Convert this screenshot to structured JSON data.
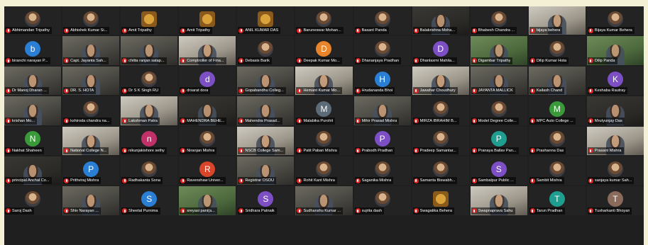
{
  "colors": {
    "frame_background": "#f4f0d6",
    "tile_background": "#232323",
    "muted_mic": "#e02424"
  },
  "participants": [
    {
      "name": "Abhimandan Tripathy",
      "view": "avatar",
      "avatar_kind": "photo"
    },
    {
      "name": "Abhishek Kumar Si...",
      "view": "avatar",
      "avatar_kind": "photo"
    },
    {
      "name": "Amit Tripathy",
      "view": "avatar",
      "avatar_kind": "logo"
    },
    {
      "name": "Amit Tripathy",
      "view": "avatar",
      "avatar_kind": "logo"
    },
    {
      "name": "ANIL KUMAR DAS",
      "view": "avatar",
      "avatar_kind": "logo"
    },
    {
      "name": "Baruneswar Mohan...",
      "view": "avatar",
      "avatar_kind": "photo"
    },
    {
      "name": "Basant Panda",
      "view": "avatar",
      "avatar_kind": "photo"
    },
    {
      "name": "Balakrishna Moha...",
      "view": "video",
      "tone": "dark"
    },
    {
      "name": "Bhabesh Chandra ...",
      "view": "avatar",
      "avatar_kind": "photo"
    },
    {
      "name": "bijaya behera",
      "view": "video",
      "tone": "light"
    },
    {
      "name": "Bijaya Kumar Behera",
      "view": "avatar",
      "avatar_kind": "photo"
    },
    {
      "name": "biranchi narayan P...",
      "view": "avatar",
      "avatar_kind": "initial",
      "initial": "b",
      "color": "#2a7fd4"
    },
    {
      "name": "Capt. Jayanta Sah...",
      "view": "video",
      "tone": "mid"
    },
    {
      "name": "chitta ranjan satap...",
      "view": "video",
      "tone": "mid"
    },
    {
      "name": "Comptroller of Fina...",
      "view": "video",
      "tone": "light"
    },
    {
      "name": "Debasis Barik",
      "view": "avatar",
      "avatar_kind": "photo"
    },
    {
      "name": "Deepak Kumar Mo...",
      "view": "avatar",
      "avatar_kind": "initial",
      "initial": "D",
      "color": "#e8842a"
    },
    {
      "name": "Dhananjaya Pradhan",
      "view": "avatar",
      "avatar_kind": "photo"
    },
    {
      "name": "Dhanlaxmi Mahila...",
      "view": "avatar",
      "avatar_kind": "initial",
      "initial": "D",
      "color": "#7d4fc4"
    },
    {
      "name": "Digambar Tripathy",
      "view": "video",
      "tone": "green"
    },
    {
      "name": "Dilip Kumar Hota",
      "view": "avatar",
      "avatar_kind": "photo"
    },
    {
      "name": "Dilip Panda",
      "view": "video",
      "tone": "green"
    },
    {
      "name": "Dr Manoj Dharan ...",
      "view": "video",
      "tone": "mid"
    },
    {
      "name": "DR. S. HOTA",
      "view": "video",
      "tone": "mid"
    },
    {
      "name": "Dr S K Singh RU",
      "view": "avatar",
      "avatar_kind": "photo"
    },
    {
      "name": "drsarat dora",
      "view": "avatar",
      "avatar_kind": "initial",
      "initial": "d",
      "color": "#7d4fc4"
    },
    {
      "name": "Gopabandhu Colleg...",
      "view": "video",
      "tone": "mid"
    },
    {
      "name": "Hemant Kumar Mo...",
      "view": "video",
      "tone": "light"
    },
    {
      "name": "Hrudananda Bhoi",
      "view": "avatar",
      "avatar_kind": "initial",
      "initial": "H",
      "color": "#2a7fd4"
    },
    {
      "name": "Jawahar Choudhury",
      "view": "video",
      "tone": "light"
    },
    {
      "name": "JAYANTA MALLICK",
      "view": "video",
      "tone": "mid"
    },
    {
      "name": "Kailash Chand",
      "view": "video",
      "tone": "mid"
    },
    {
      "name": "Keshaba Rautray",
      "view": "avatar",
      "avatar_kind": "initial",
      "initial": "K",
      "color": "#7d4fc4"
    },
    {
      "name": "krishan Mo...",
      "view": "video",
      "tone": "mid"
    },
    {
      "name": "kshiroda chandra na...",
      "view": "avatar",
      "avatar_kind": "photo"
    },
    {
      "name": "Lakshman Patra",
      "view": "video",
      "tone": "light"
    },
    {
      "name": "MAHENDRA BEHE...",
      "view": "video",
      "tone": "dark"
    },
    {
      "name": "Mahendra Prasad...",
      "view": "video",
      "tone": "mid"
    },
    {
      "name": "Malabika Purohit",
      "view": "avatar",
      "avatar_kind": "initial",
      "initial": "M",
      "color": "#5c6b78"
    },
    {
      "name": "Mihir Prasad Mishra",
      "view": "video",
      "tone": "mid"
    },
    {
      "name": "MIRZA IBRAHIM B...",
      "view": "avatar",
      "avatar_kind": "photo"
    },
    {
      "name": "Model Degree Colle...",
      "view": "avatar",
      "avatar_kind": "photo"
    },
    {
      "name": "MPC Auto College ...",
      "view": "avatar",
      "avatar_kind": "initial",
      "initial": "M",
      "color": "#3a9a3a"
    },
    {
      "name": "Mrutyunjay Das",
      "view": "video",
      "tone": "dark"
    },
    {
      "name": "Nakhat Shaheen",
      "view": "avatar",
      "avatar_kind": "initial",
      "initial": "N",
      "color": "#3a9a3a"
    },
    {
      "name": "National College N...",
      "view": "video",
      "tone": "light"
    },
    {
      "name": "nikunjakishore sethy",
      "view": "avatar",
      "avatar_kind": "initial",
      "initial": "n",
      "color": "#c2306a"
    },
    {
      "name": "Niranjan Mishra",
      "view": "avatar",
      "avatar_kind": "photo"
    },
    {
      "name": "NSCB College Sam...",
      "view": "video",
      "tone": "light"
    },
    {
      "name": "Patit Paban Mishra",
      "view": "avatar",
      "avatar_kind": "photo"
    },
    {
      "name": "Prabodh Pradhan",
      "view": "avatar",
      "avatar_kind": "initial",
      "initial": "P",
      "color": "#7d4fc4"
    },
    {
      "name": "Pradeep Samantar...",
      "view": "avatar",
      "avatar_kind": "photo"
    },
    {
      "name": "Pranaya Ballav Pan...",
      "view": "avatar",
      "avatar_kind": "initial",
      "initial": "P",
      "color": "#1f9d8f"
    },
    {
      "name": "Prashanna Das",
      "view": "avatar",
      "avatar_kind": "photo"
    },
    {
      "name": "Prasant Mishra",
      "view": "video",
      "tone": "light"
    },
    {
      "name": "principal Anchal Co...",
      "view": "video",
      "tone": "dark"
    },
    {
      "name": "Prithviraj Mishra",
      "view": "avatar",
      "avatar_kind": "initial",
      "initial": "P",
      "color": "#2a7fd4"
    },
    {
      "name": "Radhakanta Sona",
      "view": "avatar",
      "avatar_kind": "photo"
    },
    {
      "name": "Ravenshaw Univer...",
      "view": "avatar",
      "avatar_kind": "initial",
      "initial": "R",
      "color": "#d8452a"
    },
    {
      "name": "Registrar OSOU",
      "view": "video",
      "tone": "mid"
    },
    {
      "name": "Rohit Kant Mishra",
      "view": "avatar",
      "avatar_kind": "photo"
    },
    {
      "name": "Saganika Mishra",
      "view": "avatar",
      "avatar_kind": "photo"
    },
    {
      "name": "Samanta Biswabh...",
      "view": "avatar",
      "avatar_kind": "photo"
    },
    {
      "name": "Sambalpur Public ...",
      "view": "avatar",
      "avatar_kind": "initial",
      "initial": "S",
      "color": "#7d4fc4"
    },
    {
      "name": "Sambit Mishra",
      "view": "avatar",
      "avatar_kind": "photo"
    },
    {
      "name": "sanjaya kumar Sah...",
      "view": "avatar",
      "avatar_kind": "photo"
    },
    {
      "name": "Saroj Dash",
      "view": "avatar",
      "avatar_kind": "photo"
    },
    {
      "name": "Shiv Narayan ...",
      "view": "video",
      "tone": "mid"
    },
    {
      "name": "Sheetal Purnima",
      "view": "avatar",
      "avatar_kind": "initial",
      "initial": "S",
      "color": "#2a7fd4"
    },
    {
      "name": "sreyasi pani(a...",
      "view": "video",
      "tone": "green"
    },
    {
      "name": "Sridhara Patnaik",
      "view": "avatar",
      "avatar_kind": "initial",
      "initial": "S",
      "color": "#7d4fc4"
    },
    {
      "name": "Sudhanshu Kumar ...",
      "view": "video",
      "tone": "mid"
    },
    {
      "name": "sujrita dash",
      "view": "avatar",
      "avatar_kind": "photo"
    },
    {
      "name": "Swagatika Behera",
      "view": "avatar",
      "avatar_kind": "logo"
    },
    {
      "name": "Swapnaprava Sahu",
      "view": "video",
      "tone": "light"
    },
    {
      "name": "Tarun Pradhan",
      "view": "avatar",
      "avatar_kind": "initial",
      "initial": "T",
      "color": "#1f9d8f"
    },
    {
      "name": "Tusharkanti Bhoyan",
      "view": "avatar",
      "avatar_kind": "initial",
      "initial": "T",
      "color": "#8a6a5a"
    }
  ]
}
